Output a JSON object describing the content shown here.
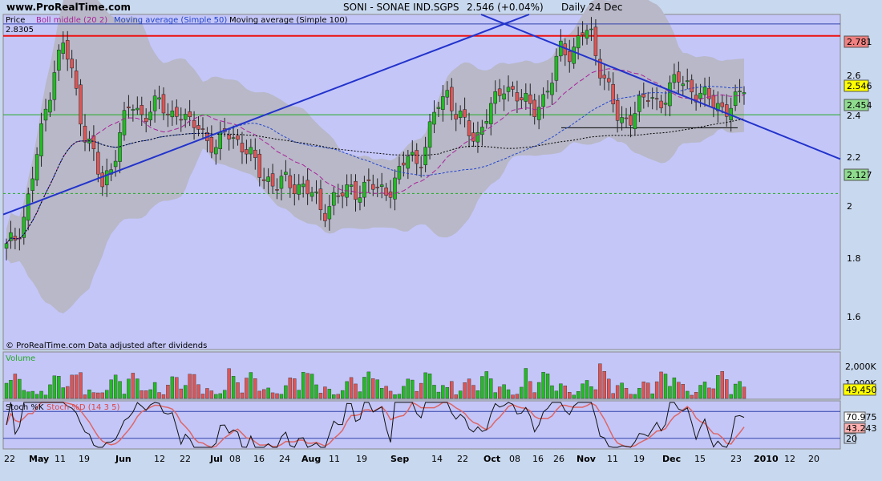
{
  "header": {
    "site": "www.ProRealTime.com",
    "legend_price": "Price",
    "legend_boll": "Boll middle (20 2)",
    "legend_ma50": "Moving average (Simple 50)",
    "legend_ma100": "Moving average (Simple 100)",
    "instrument": "SONI - SONAE IND.SGPS",
    "last_quote": "2.546 (+0.04%)",
    "period": "Daily 24 Dec",
    "high_label": "2.8305",
    "footer_note": "© ProRealTime.com  Data adjusted after dividends"
  },
  "price_panel": {
    "ticks": [
      "2.6",
      "2.4",
      "2.2",
      "2",
      "1.8",
      "1.6"
    ],
    "tags": [
      {
        "label": "2.781",
        "value": 2.781,
        "bg": "#f08080"
      },
      {
        "label": "2.546",
        "value": 2.546,
        "bg": "#ffff00"
      },
      {
        "label": "2.454",
        "value": 2.454,
        "bg": "#8fdc8f"
      },
      {
        "label": "2.127",
        "value": 2.127,
        "bg": "#8fdc8f"
      }
    ],
    "ylim": [
      1.48,
      2.87
    ]
  },
  "volume_panel": {
    "title": "Volume",
    "ticks": [
      "2,000K",
      "1,000K"
    ],
    "tag": "49,450"
  },
  "stoch_panel": {
    "title_k": "Stoch %K",
    "title_d": "Stoch %D (14 3 5)",
    "tags": [
      {
        "label": "70.975",
        "bg": "#ffffff"
      },
      {
        "label": "43.243",
        "bg": "#ffb0b0"
      },
      {
        "label": "20",
        "bg": "#c8d8ee"
      }
    ]
  },
  "x_axis": {
    "labels": [
      "22",
      "May",
      "11",
      "19",
      "Jun",
      "12",
      "22",
      "Jul",
      "08",
      "16",
      "24",
      "Aug",
      "11",
      "19",
      "Sep",
      "14",
      "22",
      "Oct",
      "08",
      "16",
      "26",
      "Nov",
      "11",
      "19",
      "Dec",
      "15",
      "23",
      "2010",
      "12",
      "20"
    ]
  },
  "colors": {
    "up": "#22bb22",
    "down": "#dd5555",
    "trendline": "#2233cc",
    "resistance": "#ee1111",
    "band": "#b8b8c8",
    "panel_bg": "#c4c6f8"
  },
  "chart_data": [
    {
      "type": "candlestick",
      "title": "SONI - SONAE IND.SGPS",
      "ylim": [
        1.48,
        2.87
      ],
      "period": "2009-04-22 to 2009-12-24",
      "close_path": [
        1.9,
        1.95,
        2.05,
        2.25,
        2.45,
        2.65,
        2.75,
        2.6,
        2.4,
        2.3,
        2.15,
        2.25,
        2.4,
        2.5,
        2.45,
        2.48,
        2.5,
        2.45,
        2.48,
        2.4,
        2.42,
        2.35,
        2.3,
        2.4,
        2.35,
        2.3,
        2.25,
        2.2,
        2.15,
        2.18,
        2.17,
        2.15,
        2.12,
        2.05,
        2.1,
        2.12,
        2.15,
        2.14,
        2.16,
        2.14,
        2.15,
        2.2,
        2.3,
        2.25,
        2.35,
        2.5,
        2.55,
        2.45,
        2.4,
        2.35,
        2.45,
        2.5,
        2.58,
        2.55,
        2.5,
        2.48,
        2.52,
        2.6,
        2.75,
        2.7,
        2.8,
        2.78,
        2.65,
        2.55,
        2.4,
        2.45,
        2.5,
        2.52,
        2.5,
        2.55,
        2.6,
        2.58,
        2.55,
        2.52,
        2.5,
        2.48,
        2.5,
        2.546
      ],
      "last": 2.546,
      "levels": {
        "resistance": 2.781,
        "support1": 2.454,
        "support2": 2.127,
        "year_high": 2.8305
      }
    },
    {
      "type": "bar",
      "title": "Volume",
      "unit": "K",
      "last": 49450,
      "peak_approx": 2400
    },
    {
      "type": "line",
      "title": "Stoch %K / Stoch %D (14 3 5)",
      "ylim": [
        0,
        100
      ],
      "k_last": 70.975,
      "d_last": 43.243,
      "levels": [
        20,
        80
      ]
    }
  ]
}
